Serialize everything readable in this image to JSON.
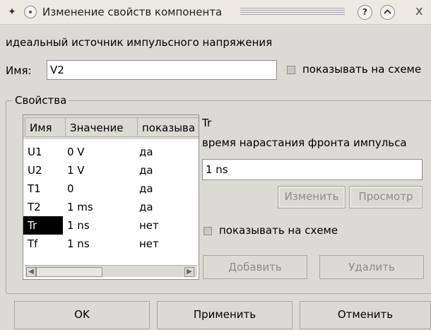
{
  "window": {
    "title": "Изменение свойств компонента",
    "help_label": "?",
    "minimize_label": "^",
    "close_label": "x"
  },
  "component_description": "идеальный источник импульсного напряжения",
  "name": {
    "label": "Имя:",
    "value": "V2",
    "show_on_schematic": {
      "label": "показывать на схеме",
      "checked": false
    }
  },
  "properties": {
    "group_title": "Свойства",
    "columns": [
      "Имя",
      "Значение",
      "показыва"
    ],
    "rows": [
      {
        "name": "U1",
        "value": "0 V",
        "show": "да"
      },
      {
        "name": "U2",
        "value": "1 V",
        "show": "да"
      },
      {
        "name": "T1",
        "value": "0",
        "show": "да"
      },
      {
        "name": "T2",
        "value": "1 ms",
        "show": "да"
      },
      {
        "name": "Tr",
        "value": "1 ns",
        "show": "нет",
        "selected": true
      },
      {
        "name": "Tf",
        "value": "1 ns",
        "show": "нет"
      }
    ],
    "selected": {
      "name": "Tr",
      "description": "время нарастания фронта импульса",
      "value": "1 ns"
    },
    "edit_button": "Изменить",
    "browse_button": "Просмотр",
    "show_on_schematic": {
      "label": "показывать на схеме",
      "checked": false
    },
    "add_button": "Добавить",
    "remove_button": "Удалить"
  },
  "buttons": {
    "ok": "OK",
    "apply": "Применить",
    "cancel": "Отменить"
  },
  "colors": {
    "background": "#dcdad5",
    "selection": "#000000",
    "disabled_text": "#8e8c87"
  }
}
